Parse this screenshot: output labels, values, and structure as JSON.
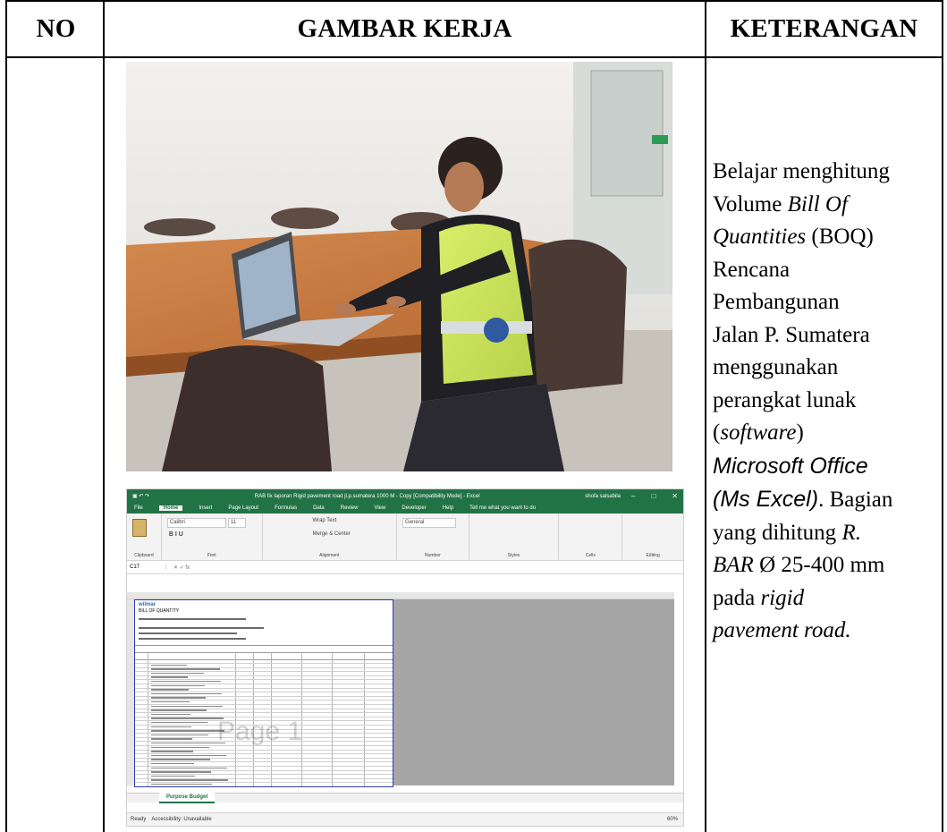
{
  "table": {
    "headers": {
      "no": "NO",
      "gambar": "GAMBAR KERJA",
      "keterangan": "KETERANGAN"
    },
    "row": {
      "keterangan": {
        "p1": "Belajar menghitung",
        "p2": "Volume ",
        "p3": "Bill Of",
        "p4": "Quantities",
        "p5": " (BOQ)",
        "p6": "Rencana",
        "p7": "Pembangunan",
        "p8": "Jalan P. Sumatera",
        "p9": "menggunakan",
        "p10": "perangkat lunak",
        "p11": "(",
        "p12": "software",
        "p13": ")",
        "p14": "Microsoft Office",
        "p15": "(Ms Excel)",
        "p16": ". Bagian",
        "p17": "yang dihitung ",
        "p18": "R.",
        "p19": "BAR",
        "p20": " Ø 25-400 mm",
        "p21": "pada ",
        "p22": "rigid",
        "p23": "pavement road."
      }
    }
  },
  "excel": {
    "title": "RAB fix laporan Rigid pavement road jl.p.sumatera 1000 M - Copy [Compatibility Mode] - Excel",
    "user": "shofa salsabila",
    "menu": [
      "File",
      "Home",
      "Insert",
      "Page Layout",
      "Formulas",
      "Data",
      "Review",
      "View",
      "Developer",
      "Help",
      "Tell me what you want to do"
    ],
    "ribbon_groups": [
      "Clipboard",
      "Font",
      "Alignment",
      "Number",
      "Styles",
      "Cells",
      "Editing"
    ],
    "font_name": "Calibri",
    "font_size": "11",
    "wrap_text": "Wrap Text",
    "merge_center": "Merge & Center",
    "number_format": "General",
    "name_box": "C17",
    "sheet_header": "wilmar",
    "sheet_title": "BILL OF QUANTITY",
    "watermark": "Page 1",
    "sheet_tab": "Purpose Budget",
    "status": "Ready",
    "accessibility": "Accessibility: Unavailable",
    "zoom": "60%"
  }
}
